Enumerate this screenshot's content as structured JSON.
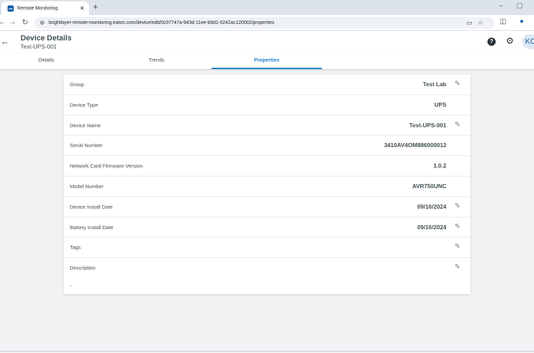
{
  "browser": {
    "tab_title": "Remote Monitoring",
    "favicon_text": "em",
    "url": "brightlayer-remote-monitoring.eaton.com/device/edit/0c07747a-943d-11ee-b9d1-0242ac120002/properties"
  },
  "header": {
    "title": "Device Details",
    "subtitle": "Test-UPS-001",
    "avatar_initials": "KC"
  },
  "tabs": [
    {
      "label": "Details",
      "active": false
    },
    {
      "label": "Trends",
      "active": false
    },
    {
      "label": "Properties",
      "active": true
    }
  ],
  "properties": [
    {
      "label": "Group",
      "value": "Test Lab",
      "editable": true
    },
    {
      "label": "Device Type",
      "value": "UPS",
      "editable": false
    },
    {
      "label": "Device Name",
      "value": "Test-UPS-001",
      "editable": true
    },
    {
      "label": "Serial Number",
      "value": "3410AV4OM886000012",
      "editable": false
    },
    {
      "label": "Network Card Firmware Version",
      "value": "1.0.2",
      "editable": false
    },
    {
      "label": "Model Number",
      "value": "AVR750UNC",
      "editable": false
    },
    {
      "label": "Device Install Date",
      "value": "09/16/2024",
      "editable": true
    },
    {
      "label": "Battery Install Date",
      "value": "09/16/2024",
      "editable": true
    },
    {
      "label": "Tags",
      "value": "",
      "editable": true
    },
    {
      "label": "Description",
      "value": "",
      "editable": true
    }
  ],
  "description_value": "-",
  "colors": {
    "accent": "#1a7ec8",
    "background": "#f1f2f4",
    "text": "#424e54"
  }
}
